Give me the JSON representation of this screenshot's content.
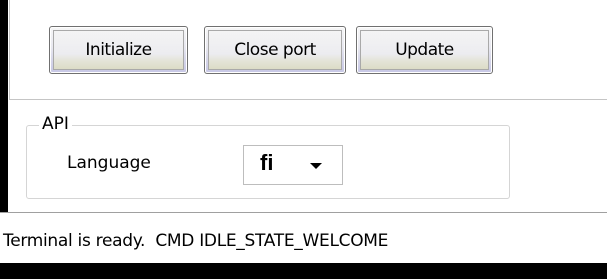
{
  "toolbar": {
    "initialize_label": "Initialize",
    "close_port_label": "Close port",
    "update_label": "Update"
  },
  "api": {
    "group_title": "API",
    "language_label": "Language",
    "language_value": "fi"
  },
  "status": {
    "text": "Terminal is ready.  CMD IDLE_STATE_WELCOME"
  },
  "icons": {
    "dropdown": "chevron-down-icon"
  },
  "colors": {
    "window_bg": "#ffffff",
    "screen_bg": "#000000",
    "button_border": "#707070",
    "button_accent": "#c7c7e6"
  }
}
